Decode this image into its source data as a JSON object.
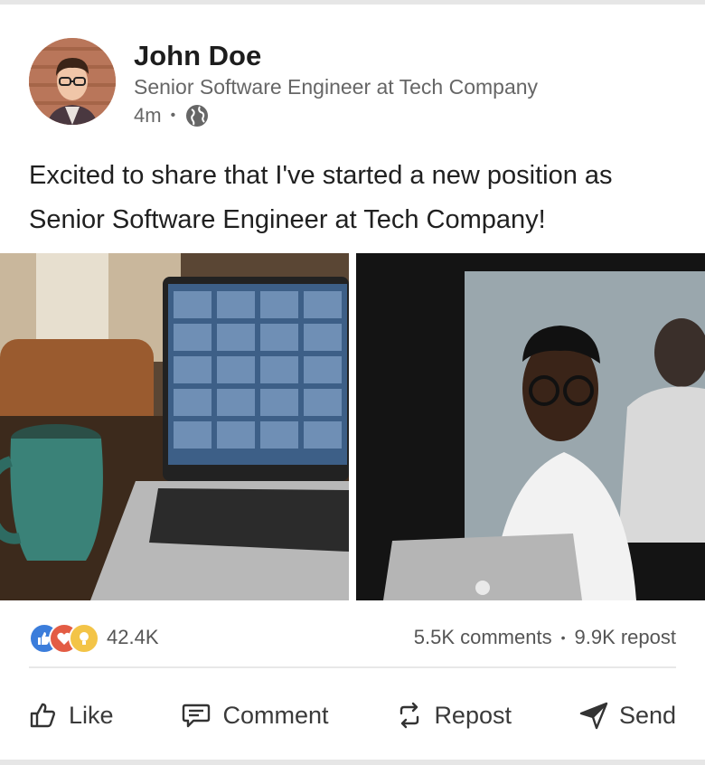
{
  "post": {
    "author": {
      "name": "John Doe",
      "headline": "Senior Software Engineer at Tech Company",
      "time": "4m",
      "visibility_icon": "globe-icon"
    },
    "text": "Excited to share that I've started a new position as Senior Software Engineer at Tech Company!",
    "images": [
      {
        "description_icon": "photo-laptop-video-call"
      },
      {
        "description_icon": "photo-speaker-with-laptop"
      }
    ],
    "stats": {
      "reaction_icons": [
        "like-reaction-icon",
        "love-reaction-icon",
        "insightful-reaction-icon"
      ],
      "reactions_count": "42.4K",
      "comments": "5.5K comments",
      "separator": "•",
      "reposts": "9.9K repost"
    },
    "actions": [
      {
        "label": "Like",
        "icon": "thumbs-up-icon"
      },
      {
        "label": "Comment",
        "icon": "comment-icon"
      },
      {
        "label": "Repost",
        "icon": "repost-icon"
      },
      {
        "label": "Send",
        "icon": "send-icon"
      }
    ]
  },
  "colors": {
    "reaction_like": "#3b7ddb",
    "reaction_love": "#e35c44",
    "reaction_insight": "#f3c447",
    "text_secondary": "#666666"
  }
}
